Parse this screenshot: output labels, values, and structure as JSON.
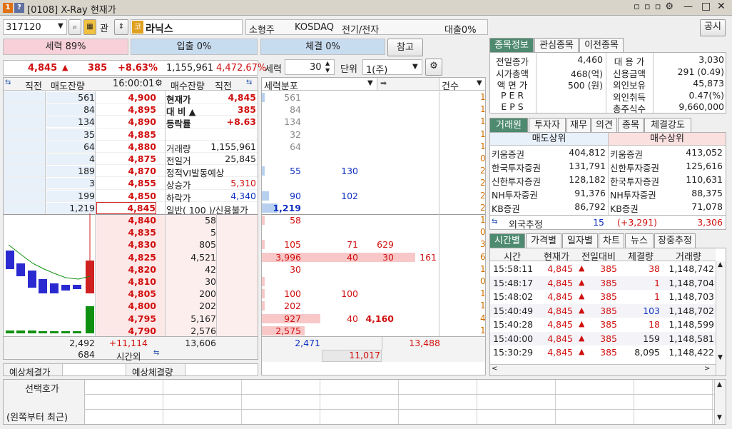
{
  "window": {
    "title": "[0108] X-Ray 현재가",
    "badge1": "1",
    "badge2": "?",
    "controls": [
      "▫",
      "▫",
      "▫",
      "⚙",
      "—",
      "□",
      "✕"
    ]
  },
  "top": {
    "code": "317120",
    "gwan": "관",
    "stock_badge": "코",
    "stock_name": "라닉스",
    "type": "소형주",
    "market": "KOSDAQ",
    "sector": "전기/전자",
    "loan": "대출0%",
    "notice": "공시"
  },
  "strength": {
    "seryeok": "세력 89%",
    "inflow": "입출 0%",
    "fill": "체결 0%",
    "ref_btn": "참고"
  },
  "price_line": {
    "price": "4,845",
    "arrow": "▲",
    "change": "385",
    "pct": "+8.63%",
    "volume": "1,155,961",
    "ratio": "4,472.67%"
  },
  "controls": {
    "seryeok_label": "세력",
    "seryeok_val": "30",
    "unit_label": "단위",
    "unit_val": "1(주)"
  },
  "orderbook": {
    "headers": {
      "prev": "직전",
      "ask_rem": "매도잔량",
      "time": "16:00:01",
      "bid_rem": "매수잔량",
      "prev2": "직전",
      "dist": "세력분포",
      "cnt": "건수"
    },
    "asks": [
      [
        "561",
        "4,900"
      ],
      [
        "84",
        "4,895"
      ],
      [
        "134",
        "4,890"
      ],
      [
        "35",
        "4,885"
      ],
      [
        "64",
        "4,880"
      ],
      [
        "4",
        "4,875"
      ],
      [
        "189",
        "4,870"
      ],
      [
        "3",
        "4,855"
      ],
      [
        "199",
        "4,850"
      ],
      [
        "1,219",
        "4,845"
      ]
    ],
    "bids": [
      [
        "4,840",
        "58"
      ],
      [
        "4,835",
        "5"
      ],
      [
        "4,830",
        "805"
      ],
      [
        "4,825",
        "4,521"
      ],
      [
        "4,820",
        "42"
      ],
      [
        "4,810",
        "30"
      ],
      [
        "4,805",
        "200"
      ],
      [
        "4,800",
        "202"
      ],
      [
        "4,795",
        "5,167"
      ],
      [
        "4,790",
        "2,576"
      ]
    ],
    "info": [
      [
        "현재가",
        "4,845"
      ],
      [
        "대 비 ▲",
        "385"
      ],
      [
        "등락률",
        "+8.63"
      ],
      [
        "",
        ""
      ],
      [
        "거래량",
        "1,155,961"
      ],
      [
        "전일거",
        "25,845"
      ],
      [
        "정적VI발동예상",
        ""
      ],
      [
        "상승가",
        "5,310"
      ],
      [
        "하락가",
        "4,340"
      ],
      [
        "일반( 100 )/신용불가",
        ""
      ]
    ],
    "ask_total": "2,492",
    "diff": "+11,114",
    "bid_total": "13,606",
    "after": "684",
    "after_label": "시간외",
    "exp_price": "예상체결가",
    "exp_qty": "예상체결량"
  },
  "dist": {
    "ask": [
      [
        "561",
        "",
        "",
        ""
      ],
      [
        "84",
        "",
        "",
        ""
      ],
      [
        "134",
        "",
        "",
        ""
      ],
      [
        "32",
        "",
        "",
        ""
      ],
      [
        "64",
        "",
        "",
        ""
      ],
      [
        "",
        "",
        "",
        ""
      ],
      [
        "55",
        "130",
        "",
        ""
      ],
      [
        "",
        "",
        "",
        ""
      ],
      [
        "90",
        "102",
        "",
        ""
      ],
      [
        "1,219",
        "",
        "",
        ""
      ]
    ],
    "bid": [
      [
        "58",
        "",
        "",
        ""
      ],
      [
        "",
        "",
        "",
        ""
      ],
      [
        "105",
        "71",
        "629",
        ""
      ],
      [
        "3,996",
        "40",
        "30",
        "161"
      ],
      [
        "30",
        "",
        "",
        ""
      ],
      [
        "",
        "",
        "",
        ""
      ],
      [
        "100",
        "100",
        "",
        ""
      ],
      [
        "202",
        "",
        "",
        ""
      ],
      [
        "927",
        "40",
        "4,160",
        ""
      ],
      [
        "2,575",
        "",
        "",
        ""
      ]
    ],
    "sum1": "2,471",
    "sum2": "13,488",
    "sum3": "11,017"
  },
  "info_panel": {
    "tabs": [
      "종목정보",
      "관심종목",
      "이전종목"
    ],
    "left": [
      [
        "전일종가",
        "4,460"
      ],
      [
        "시가총액",
        "468(억)"
      ],
      [
        "액 면 가",
        "500 (원)"
      ],
      [
        "P E R",
        ""
      ],
      [
        "E P S",
        ""
      ]
    ],
    "right": [
      [
        "대 용 가",
        "3,030"
      ],
      [
        "신용금액",
        "291  (0.49)"
      ],
      [
        "외인보유",
        "45,873"
      ],
      [
        "외인취득",
        "0.47(%)"
      ],
      [
        "총주식수",
        "9,660,000"
      ]
    ]
  },
  "broker": {
    "tabs": [
      "거래원",
      "투자자",
      "재무",
      "의견",
      "종목",
      "체결강도"
    ],
    "sell_header": "매도상위",
    "buy_header": "매수상위",
    "rows": [
      [
        "키움증권",
        "404,812",
        "키움증권",
        "413,052"
      ],
      [
        "한국투자증권",
        "131,791",
        "신한투자증권",
        "125,616"
      ],
      [
        "신한투자증권",
        "128,182",
        "한국투자증권",
        "110,631"
      ],
      [
        "NH투자증권",
        "91,376",
        "NH투자증권",
        "88,375"
      ],
      [
        "KB증권",
        "86,792",
        "KB증권",
        "71,078"
      ]
    ],
    "foreign_label": "외국추정",
    "foreign_sell": "15",
    "foreign_diff": "(+3,291)",
    "foreign_buy": "3,306"
  },
  "trades": {
    "tabs": [
      "시간별",
      "가격별",
      "일자별",
      "차트",
      "뉴스",
      "장중추정"
    ],
    "headers": [
      "시간",
      "현재가",
      "전일대비",
      "체결량",
      "거래량"
    ],
    "rows": [
      [
        "15:58:11",
        "4,845",
        "385",
        "38",
        "1,148,742"
      ],
      [
        "15:48:17",
        "4,845",
        "385",
        "1",
        "1,148,704"
      ],
      [
        "15:48:02",
        "4,845",
        "385",
        "1",
        "1,148,703"
      ],
      [
        "15:40:49",
        "4,845",
        "385",
        "103",
        "1,148,702"
      ],
      [
        "15:40:28",
        "4,845",
        "385",
        "18",
        "1,148,599"
      ],
      [
        "15:40:00",
        "4,845",
        "385",
        "159",
        "1,148,581"
      ],
      [
        "15:30:29",
        "4,845",
        "385",
        "8,095",
        "1,148,422"
      ]
    ]
  },
  "bottom": {
    "sel": "선택호가",
    "recent": "(왼쪽부터 최근)"
  },
  "colors": {
    "accent": "#4e8a70",
    "up": "#d01010",
    "down": "#1030c0",
    "ask_bg": "#e8f0fa",
    "bid_bg": "#fde8e8"
  }
}
